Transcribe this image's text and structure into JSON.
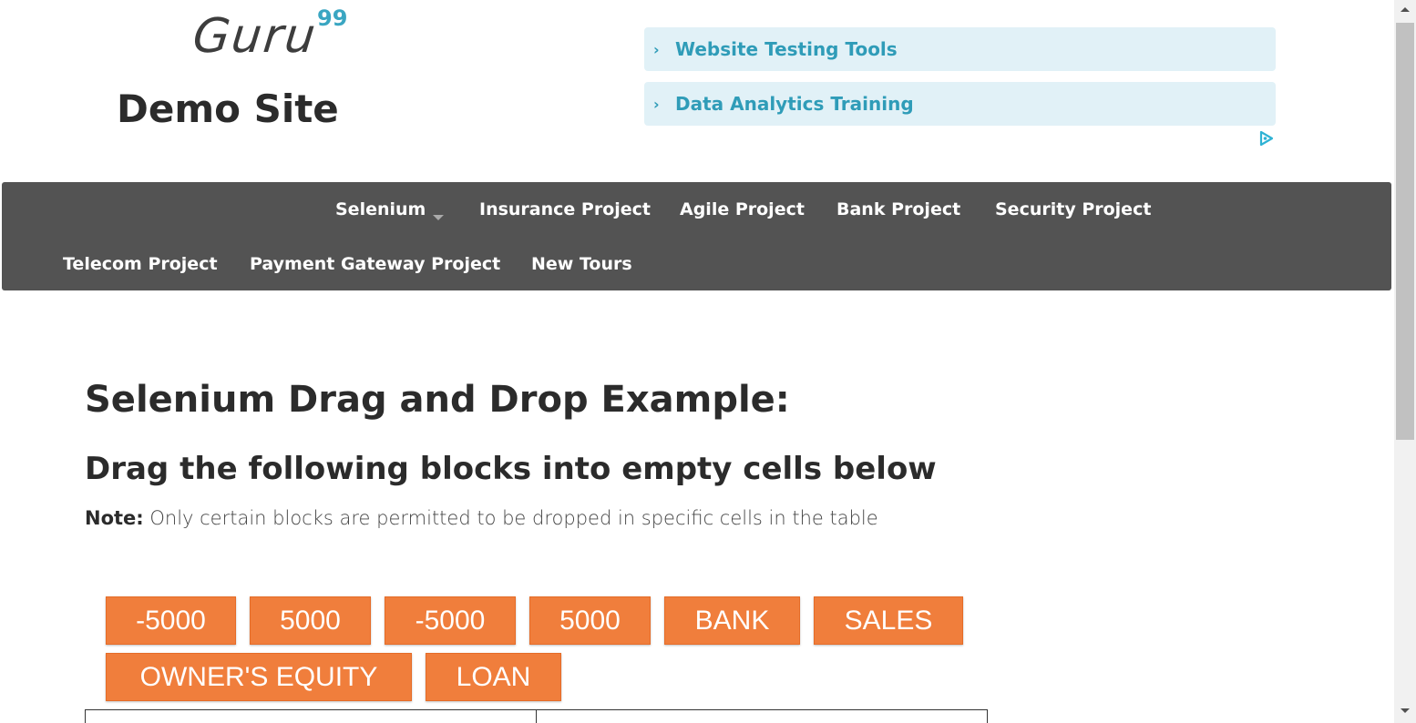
{
  "header": {
    "logo_text": "Guru",
    "logo_sup": "99",
    "site_title": "Demo Site"
  },
  "ads": [
    {
      "label": "Website Testing Tools"
    },
    {
      "label": "Data Analytics Training"
    }
  ],
  "nav": {
    "items": [
      {
        "label": "Selenium",
        "has_dropdown": true
      },
      {
        "label": "Insurance Project"
      },
      {
        "label": "Agile Project"
      },
      {
        "label": "Bank Project"
      },
      {
        "label": "Security Project"
      },
      {
        "label": "Telecom Project"
      },
      {
        "label": "Payment Gateway Project"
      },
      {
        "label": "New Tours"
      }
    ]
  },
  "content": {
    "title": "Selenium Drag and Drop Example:",
    "subtitle": "Drag the following blocks into empty cells below",
    "note_label": "Note:",
    "note_text": " Only certain blocks are permitted to be dropped in specific cells in the table",
    "blocks": [
      {
        "label": "-5000"
      },
      {
        "label": "5000"
      },
      {
        "label": "-5000"
      },
      {
        "label": "5000"
      },
      {
        "label": "BANK"
      },
      {
        "label": "SALES"
      },
      {
        "label": "OWNER'S EQUITY"
      },
      {
        "label": "LOAN"
      }
    ]
  },
  "colors": {
    "nav_bg": "#535353",
    "block_bg": "#f07e3c",
    "ad_bg": "#e1f1f7",
    "ad_text": "#2f9cb8"
  }
}
